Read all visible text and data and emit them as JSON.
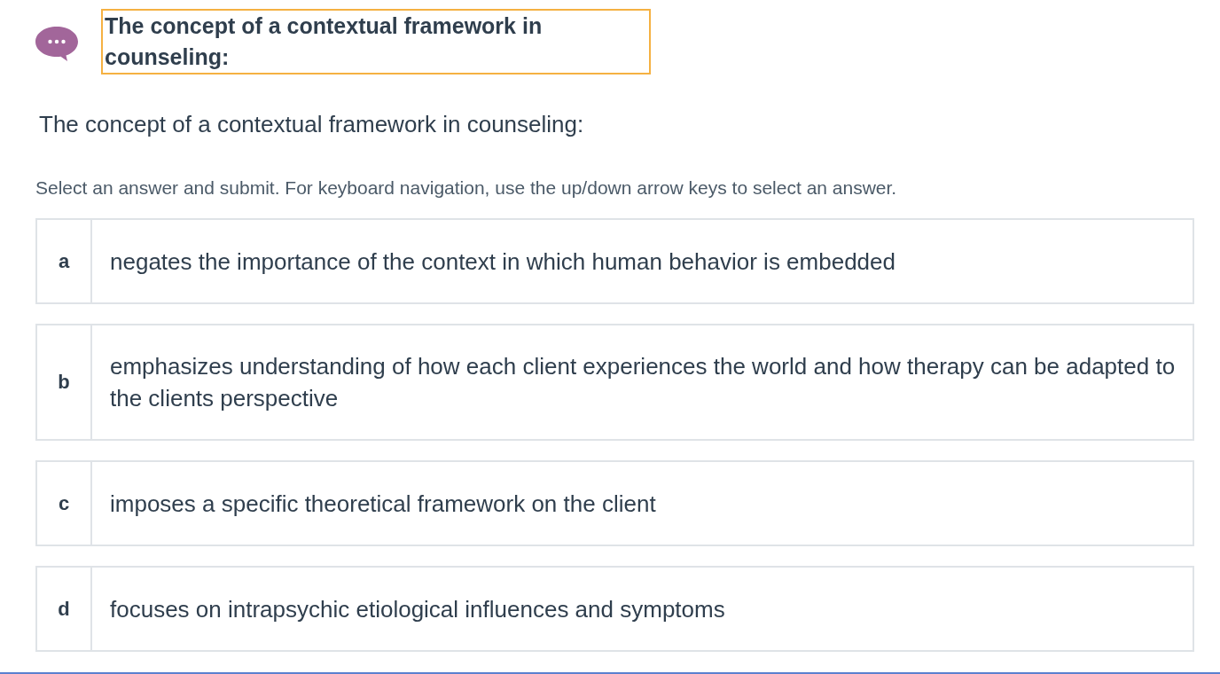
{
  "header": {
    "title": "The concept of a contextual framework in counseling:",
    "focused": true
  },
  "question": "The concept of a contextual framework in counseling:",
  "instructions": "Select an answer and submit. For keyboard navigation, use the up/down arrow keys to select an answer.",
  "options": [
    {
      "letter": "a",
      "text": "negates the importance of the context in which human behavior is embedded",
      "selected": false
    },
    {
      "letter": "b",
      "text": "emphasizes understanding of how each client experiences the world and how therapy can be adapted to the clients perspective",
      "selected": false
    },
    {
      "letter": "c",
      "text": "imposes a specific theoretical framework on the client",
      "selected": false
    },
    {
      "letter": "d",
      "text": "focuses on intrapsychic etiological influences and symptoms",
      "selected": false
    }
  ]
}
